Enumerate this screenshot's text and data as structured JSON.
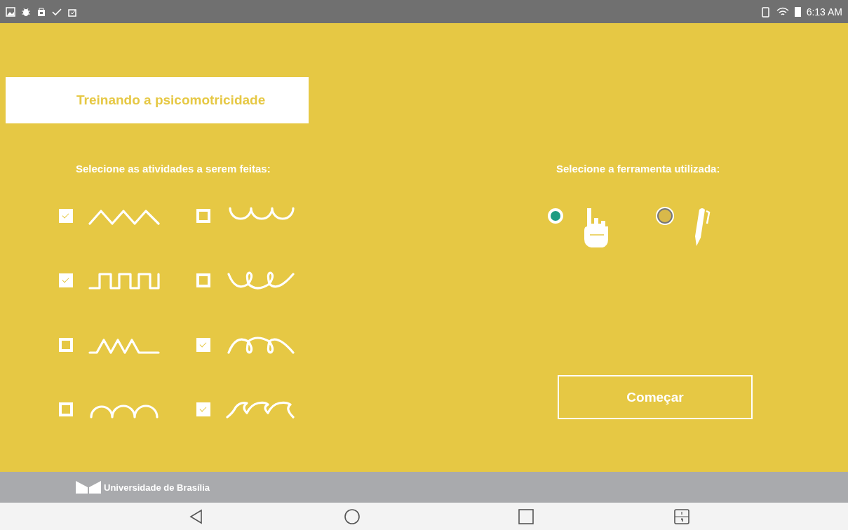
{
  "status_bar": {
    "time": "6:13 AM"
  },
  "header": {
    "title": "Treinando a psicomotricidade"
  },
  "activities": {
    "heading": "Selecione as atividades a serem feitas:",
    "items": [
      {
        "kind": "zigzag",
        "checked": true
      },
      {
        "kind": "cups",
        "checked": false
      },
      {
        "kind": "square",
        "checked": true
      },
      {
        "kind": "loops-down",
        "checked": false
      },
      {
        "kind": "triangle",
        "checked": false
      },
      {
        "kind": "loops-up",
        "checked": true
      },
      {
        "kind": "arches",
        "checked": false
      },
      {
        "kind": "waves",
        "checked": true
      }
    ]
  },
  "tools": {
    "heading": "Selecione a ferramenta utilizada:",
    "items": [
      {
        "kind": "finger",
        "selected": true
      },
      {
        "kind": "pen",
        "selected": false
      }
    ]
  },
  "start_button": "Começar",
  "footer": {
    "brand": "Universidade de Brasília"
  }
}
